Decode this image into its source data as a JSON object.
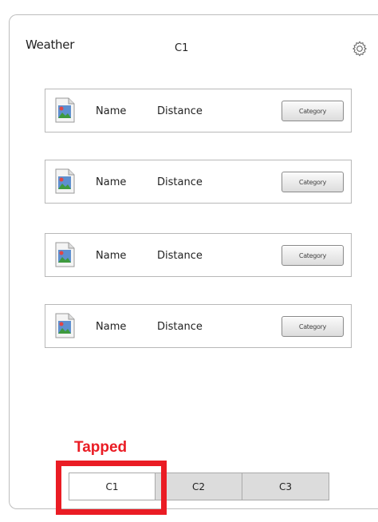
{
  "header": {
    "title": "Weather",
    "active_tab": "C1"
  },
  "list": {
    "items": [
      {
        "name": "Name",
        "distance": "Distance",
        "button": "Category"
      },
      {
        "name": "Name",
        "distance": "Distance",
        "button": "Category"
      },
      {
        "name": "Name",
        "distance": "Distance",
        "button": "Category"
      },
      {
        "name": "Name",
        "distance": "Distance",
        "button": "Category"
      }
    ]
  },
  "annotation": {
    "label": "Tapped",
    "color": "#ea1c24"
  },
  "tabs": [
    {
      "label": "C1"
    },
    {
      "label": "C2"
    },
    {
      "label": "C3"
    }
  ],
  "icons": {
    "settings": "gear-icon",
    "item": "image-file-icon"
  }
}
